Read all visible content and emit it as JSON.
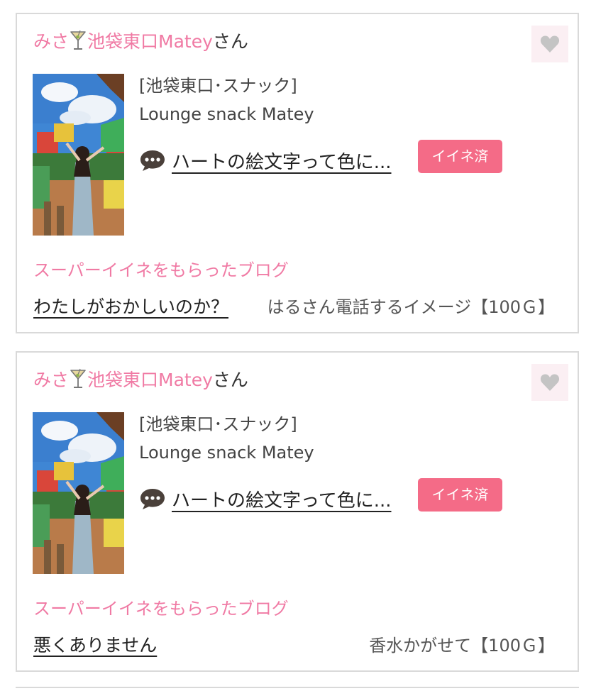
{
  "colors": {
    "accent_pink": "#f07aa4",
    "badge_pink": "#f46b87",
    "border": "#d9d9d9",
    "like_bg": "#fbeff3",
    "heart_gray": "#c4c4c4"
  },
  "cards": [
    {
      "user_name": "みさ",
      "user_icon": "cocktail-glass-icon",
      "user_shop": "池袋東口Matey",
      "user_suffix": "さん",
      "like_icon": "heart-icon",
      "shop_category": "[池袋東口･スナック]",
      "shop_name": "Lounge snack Matey",
      "comment_icon": "speech-bubble-icon",
      "blog_title": "ハートの絵文字って色に...",
      "iine_label": "イイネ済",
      "super_heading": "スーパーイイネをもらったブログ",
      "super_blog_title": "わたしがおかしいのか？",
      "super_gift": "はるさん電話するイメージ【100Ｇ】"
    },
    {
      "user_name": "みさ",
      "user_icon": "cocktail-glass-icon",
      "user_shop": "池袋東口Matey",
      "user_suffix": "さん",
      "like_icon": "heart-icon",
      "shop_category": "[池袋東口･スナック]",
      "shop_name": "Lounge snack Matey",
      "comment_icon": "speech-bubble-icon",
      "blog_title": "ハートの絵文字って色に...",
      "iine_label": "イイネ済",
      "super_heading": "スーパーイイネをもらったブログ",
      "super_blog_title": "悪くありません",
      "super_gift": "香水かがせて【100Ｇ】"
    }
  ]
}
